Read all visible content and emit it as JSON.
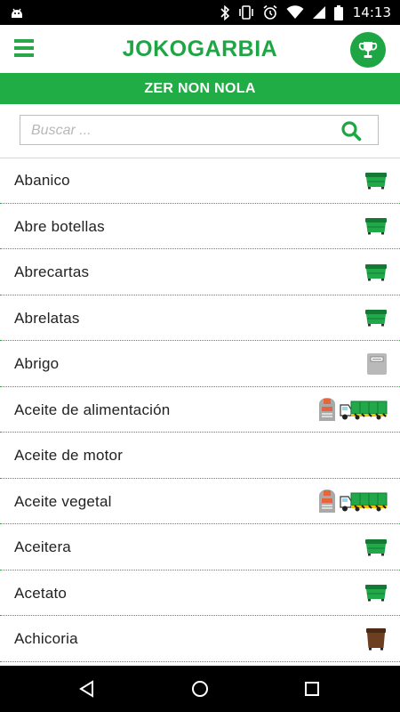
{
  "status_bar": {
    "time": "14:13",
    "icons": [
      "android-debug-icon",
      "bluetooth-icon",
      "vibrate-icon",
      "alarm-icon",
      "wifi-icon",
      "signal-icon",
      "battery-icon"
    ]
  },
  "app_bar": {
    "title": "JOKOGARBIA",
    "menu_icon": "hamburger-menu-icon",
    "trophy_icon": "trophy-icon"
  },
  "banner": {
    "text": "ZER NON NOLA"
  },
  "search": {
    "placeholder": "Buscar ...",
    "value": "",
    "icon": "search-icon"
  },
  "items": [
    {
      "label": "Abanico",
      "icons": [
        "green-container-icon"
      ]
    },
    {
      "label": "Abre botellas",
      "icons": [
        "green-container-icon"
      ]
    },
    {
      "label": "Abrecartas",
      "icons": [
        "green-container-icon"
      ]
    },
    {
      "label": "Abrelatas",
      "icons": [
        "green-container-icon"
      ]
    },
    {
      "label": "Abrigo",
      "icons": [
        "clothes-container-icon"
      ]
    },
    {
      "label": "Aceite de alimentación",
      "icons": [
        "oil-container-icon",
        "garbitegi-truck-icon"
      ]
    },
    {
      "label": "Aceite de motor",
      "icons": []
    },
    {
      "label": "Aceite vegetal",
      "icons": [
        "oil-container-icon",
        "garbitegi-truck-icon"
      ]
    },
    {
      "label": "Aceitera",
      "icons": [
        "green-container-icon"
      ]
    },
    {
      "label": "Acetato",
      "icons": [
        "green-container-icon"
      ]
    },
    {
      "label": "Achicoria",
      "icons": [
        "brown-container-icon"
      ]
    }
  ],
  "colors": {
    "brand_green": "#21ad45",
    "brown": "#6b3f1f"
  },
  "nav_bar": {
    "icons": [
      "back-icon",
      "home-icon",
      "recents-icon"
    ]
  }
}
